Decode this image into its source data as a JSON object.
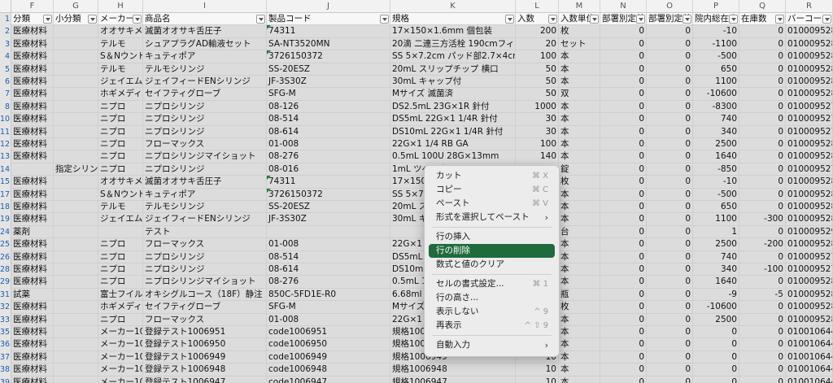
{
  "columns": [
    {
      "letter": "F",
      "label": "分類"
    },
    {
      "letter": "G",
      "label": "小分類"
    },
    {
      "letter": "H",
      "label": "メーカー"
    },
    {
      "letter": "I",
      "label": "商品名"
    },
    {
      "letter": "J",
      "label": "製品コード"
    },
    {
      "letter": "K",
      "label": "規格"
    },
    {
      "letter": "L",
      "label": "入数"
    },
    {
      "letter": "M",
      "label": "入数単位"
    },
    {
      "letter": "N",
      "label": "部署別定着"
    },
    {
      "letter": "O",
      "label": "部署別定着"
    },
    {
      "letter": "P",
      "label": "院内総在庫"
    },
    {
      "letter": "Q",
      "label": "在庫数"
    },
    {
      "letter": "R",
      "label": "バーコード"
    }
  ],
  "rows": [
    {
      "n": "1",
      "header": true
    },
    {
      "n": "2",
      "c": [
        "医療材料",
        "",
        "オオサキメデ",
        "滅菌オオサキ舌圧子",
        "74311",
        "17×150×1.6mm 個包装",
        "200",
        "枚",
        "0",
        "0",
        "-10",
        "0",
        "0100095285008"
      ]
    },
    {
      "n": "3",
      "c": [
        "医療材料",
        "",
        "テルモ",
        "シュアプラグAD輸液セット",
        "SA-NT3520MN",
        "20滴 二連三方活栓 190cmフィルター",
        "20",
        "セット",
        "0",
        "0",
        "-1100",
        "0",
        "0100095280008"
      ]
    },
    {
      "n": "4",
      "c": [
        "医療材料",
        "",
        "S＆Nウンド",
        "キュティポア",
        "3726150372",
        "SS 5×7.2cm パッド部2.7×4cm",
        "100",
        "本",
        "0",
        "0",
        "-500",
        "0",
        "0100095280088"
      ]
    },
    {
      "n": "5",
      "c": [
        "医療材料",
        "",
        "テルモ",
        "テルモシリンジ",
        "SS-20ESZ",
        "20mL スリップチップ 横口",
        "50",
        "本",
        "0",
        "0",
        "650",
        "0",
        "0100095280008"
      ]
    },
    {
      "n": "6",
      "c": [
        "医療材料",
        "",
        "ジェイエムエ",
        "ジェイフィードENシリンジ",
        "JF-3S30Z",
        "30mL キャップ付",
        "50",
        "本",
        "0",
        "0",
        "1100",
        "0",
        "0100095283008"
      ]
    },
    {
      "n": "7",
      "c": [
        "医療材料",
        "",
        "ホギメディカ",
        "セイフティグローブ",
        "SFG-M",
        "Mサイズ 滅菌済",
        "50",
        "双",
        "0",
        "0",
        "-10600",
        "0",
        "0100095284008"
      ]
    },
    {
      "n": "8",
      "c": [
        "医療材料",
        "",
        "ニプロ",
        "ニプロシリンジ",
        "08-126",
        "DS2.5mL 23G×1R 針付",
        "1000",
        "本",
        "0",
        "0",
        "-8300",
        "0",
        "0100095277008"
      ]
    },
    {
      "n": "10",
      "c": [
        "医療材料",
        "",
        "ニプロ",
        "ニプロシリンジ",
        "08-514",
        "DS5mL 22G×1 1/4R 針付",
        "30",
        "本",
        "0",
        "0",
        "740",
        "0",
        "0100095278008"
      ]
    },
    {
      "n": "11",
      "c": [
        "医療材料",
        "",
        "ニプロ",
        "ニプロシリンジ",
        "08-614",
        "DS10mL 22G×1 1/4R 針付",
        "30",
        "本",
        "0",
        "0",
        "340",
        "0",
        "0100095279008"
      ]
    },
    {
      "n": "12",
      "c": [
        "医療材料",
        "",
        "ニプロ",
        "フローマックス",
        "01-008",
        "22G×1 1/4 RB GA",
        "100",
        "本",
        "0",
        "0",
        "2500",
        "0",
        "0100095281008"
      ]
    },
    {
      "n": "13",
      "c": [
        "医療材料",
        "",
        "ニプロ",
        "ニプロシリンジマイショット",
        "08-276",
        "0.5mL 100U 28G×13mm",
        "140",
        "本",
        "0",
        "0",
        "1640",
        "0",
        "0100095280008"
      ]
    },
    {
      "n": "14",
      "c": [
        "",
        "指定シリンジ",
        "ニプロ",
        "ニプロシリンジ",
        "08-016",
        "1mL ツベルクリン 26G×1/2SB 針付",
        "300",
        "錠",
        "0",
        "0",
        "-850",
        "0",
        "0100095276008"
      ]
    },
    {
      "n": "15",
      "c": [
        "医療材料",
        "",
        "オオサキメデ",
        "滅菌オオサキ舌圧子",
        "74311",
        "17×150×1.6mm 個包装",
        "100",
        "枚",
        "0",
        "0",
        "-10",
        "0",
        "0100095285008"
      ]
    },
    {
      "n": "17",
      "c": [
        "医療材料",
        "",
        "S＆Nウンド",
        "キュティポア",
        "3726150372",
        "SS 5×7.2cm パッド部2.7×4cm",
        "100",
        "本",
        "0",
        "0",
        "-500",
        "0",
        "0100095280088"
      ]
    },
    {
      "n": "18",
      "c": [
        "医療材料",
        "",
        "テルモ",
        "テルモシリンジ",
        "SS-20ESZ",
        "20mL スリップチップ 横口",
        "50",
        "本",
        "0",
        "0",
        "650",
        "0",
        "0100095280008"
      ]
    },
    {
      "n": "19",
      "c": [
        "医療材料",
        "",
        "ジェイエムエ",
        "ジェイフィードENシリンジ",
        "JF-3S30Z",
        "30mL キャップ付",
        "50",
        "本",
        "0",
        "0",
        "1100",
        "-300",
        "0100095283008"
      ]
    },
    {
      "n": "24",
      "c": [
        "薬剤",
        "",
        "",
        "テスト",
        "",
        "",
        "",
        "台",
        "0",
        "0",
        "1",
        "0",
        "0100095294008"
      ]
    },
    {
      "n": "25",
      "c": [
        "医療材料",
        "",
        "ニプロ",
        "フローマックス",
        "01-008",
        "22G×1 1/4 RB GA",
        "100",
        "本",
        "0",
        "0",
        "2500",
        "-200",
        "0100095281008"
      ]
    },
    {
      "n": "26",
      "c": [
        "医療材料",
        "",
        "ニプロ",
        "ニプロシリンジ",
        "08-514",
        "DS5mL 22G×1 1/4R 針付",
        "30",
        "本",
        "0",
        "0",
        "740",
        "0",
        "0100095278008"
      ]
    },
    {
      "n": "28",
      "c": [
        "医療材料",
        "",
        "ニプロ",
        "ニプロシリンジ",
        "08-614",
        "DS10mL 22G×1 1/4R 針付",
        "30",
        "本",
        "0",
        "0",
        "340",
        "-100",
        "0100095279008"
      ]
    },
    {
      "n": "29",
      "c": [
        "医療材料",
        "",
        "ニプロ",
        "ニプロシリンジマイショット",
        "08-276",
        "0.5mL 100U 28G×13mm",
        "140",
        "本",
        "0",
        "0",
        "1640",
        "0",
        "0100095280008"
      ]
    },
    {
      "n": "31",
      "c": [
        "試薬",
        "",
        "富士フイルム",
        "オキシグルコース（18F）静注「FRI」",
        "850C-5FD1E-R0",
        "6.68ml",
        "",
        "瓶",
        "0",
        "0",
        "-9",
        "-5",
        "0100095286008"
      ]
    },
    {
      "n": "32",
      "c": [
        "医療材料",
        "",
        "ホギメディカ",
        "セイフティグローブ",
        "SFG-M",
        "Mサイズ 滅菌済",
        "50",
        "枚",
        "0",
        "0",
        "-10600",
        "0",
        "0100095284008"
      ]
    },
    {
      "n": "33",
      "c": [
        "医療材料",
        "",
        "ニプロ",
        "フローマックス",
        "01-008",
        "22G×1 1/4 RB GA",
        "100",
        "本",
        "0",
        "0",
        "2500",
        "0",
        "0100095281008"
      ]
    },
    {
      "n": "35",
      "c": [
        "医療材料",
        "",
        "メーカー1006",
        "登録テスト1006951",
        "code1006951",
        "規格1006951",
        "10",
        "本",
        "0",
        "0",
        "0",
        "0",
        "0100106448008"
      ]
    },
    {
      "n": "36",
      "c": [
        "医療材料",
        "",
        "メーカー1006",
        "登録テスト1006950",
        "code1006950",
        "規格1006950",
        "10",
        "本",
        "0",
        "0",
        "0",
        "0",
        "0100106447008"
      ]
    },
    {
      "n": "37",
      "c": [
        "医療材料",
        "",
        "メーカー1006",
        "登録テスト1006949",
        "code1006949",
        "規格1006949",
        "10",
        "本",
        "0",
        "0",
        "0",
        "0",
        "0100106446008"
      ]
    },
    {
      "n": "38",
      "c": [
        "医療材料",
        "",
        "メーカー1006",
        "登録テスト1006948",
        "code1006948",
        "規格1006948",
        "10",
        "本",
        "0",
        "0",
        "0",
        "0",
        "0100106445008"
      ]
    },
    {
      "n": "39",
      "c": [
        "医療材料",
        "",
        "メーカー1006",
        "登録テスト1006947",
        "code1006947",
        "規格1006947",
        "10",
        "本",
        "0",
        "0",
        "0",
        "0",
        "0100106444008"
      ]
    },
    {
      "n": "40",
      "c": [
        "医療材料",
        "",
        "ニプロ",
        "ニプロシリンジ",
        "08-514",
        "DS10mL 22G×1 1/4R 針付",
        "30",
        "本",
        "0",
        "0",
        "340",
        "0",
        "0100095279008"
      ]
    }
  ],
  "context_menu": {
    "items": [
      {
        "label": "カット",
        "shortcut": "⌘ X"
      },
      {
        "label": "コピー",
        "shortcut": "⌘ C"
      },
      {
        "label": "ペースト",
        "shortcut": "⌘ V"
      },
      {
        "label": "形式を選択してペースト",
        "submenu": true
      },
      {
        "sep": true
      },
      {
        "label": "行の挿入"
      },
      {
        "label": "行の削除",
        "active": true
      },
      {
        "label": "数式と値のクリア"
      },
      {
        "sep": true
      },
      {
        "label": "セルの書式設定...",
        "shortcut": "⌘ 1"
      },
      {
        "label": "行の高さ..."
      },
      {
        "label": "表示しない",
        "shortcut": "^ 9"
      },
      {
        "label": "再表示",
        "shortcut": "^ ⇧ 9"
      },
      {
        "sep": true
      },
      {
        "label": "自動入力",
        "submenu": true
      }
    ]
  },
  "colors": {
    "accent": "#1f6b3e",
    "row_fill": "#dcdcdc",
    "header_fill": "#f2f2f2"
  }
}
